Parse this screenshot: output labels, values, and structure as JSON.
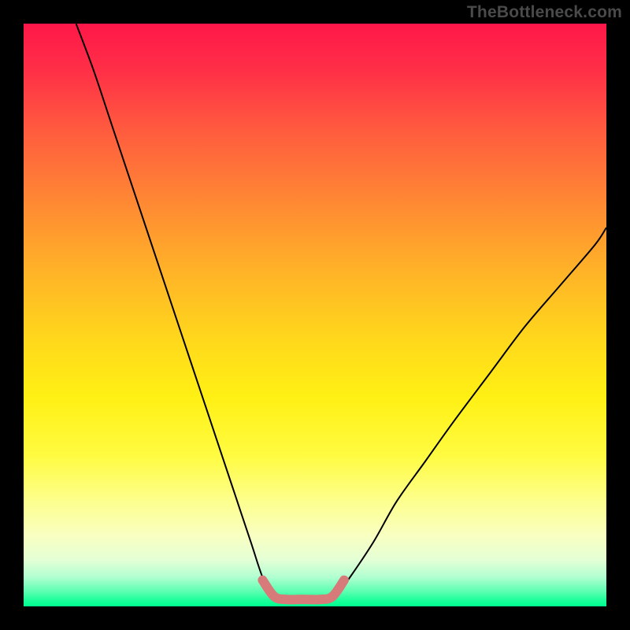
{
  "watermark": "TheBottleneck.com",
  "chart_data": {
    "type": "line",
    "title": "",
    "xlabel": "",
    "ylabel": "",
    "xlim": [
      0,
      100
    ],
    "ylim": [
      0,
      100
    ],
    "grid": false,
    "legend": false,
    "background": "rainbow-vertical-gradient",
    "annotations": [
      {
        "text": "TheBottleneck.com",
        "position": "top-right",
        "color": "#4a4a4a"
      }
    ],
    "series": [
      {
        "name": "bottleneck-curve-left",
        "color": "#000000",
        "stroke_width": 2,
        "x": [
          9,
          12,
          15,
          18,
          21,
          24,
          27,
          30,
          33,
          36,
          39,
          41,
          43
        ],
        "y": [
          100,
          92,
          83,
          74,
          65,
          56,
          47,
          38,
          29,
          20,
          11,
          5,
          1
        ]
      },
      {
        "name": "bottleneck-curve-right",
        "color": "#000000",
        "stroke_width": 2,
        "x": [
          53,
          56,
          60,
          64,
          69,
          74,
          80,
          86,
          92,
          98,
          100
        ],
        "y": [
          1,
          5,
          11,
          18,
          25,
          32,
          40,
          48,
          55,
          62,
          65
        ]
      },
      {
        "name": "highlight-band",
        "color": "#d77a7a",
        "stroke_width": 12,
        "x": [
          41,
          43,
          45,
          48,
          51,
          53,
          55
        ],
        "y": [
          4.5,
          1.7,
          1.2,
          1.2,
          1.2,
          1.7,
          4.5
        ]
      }
    ]
  }
}
